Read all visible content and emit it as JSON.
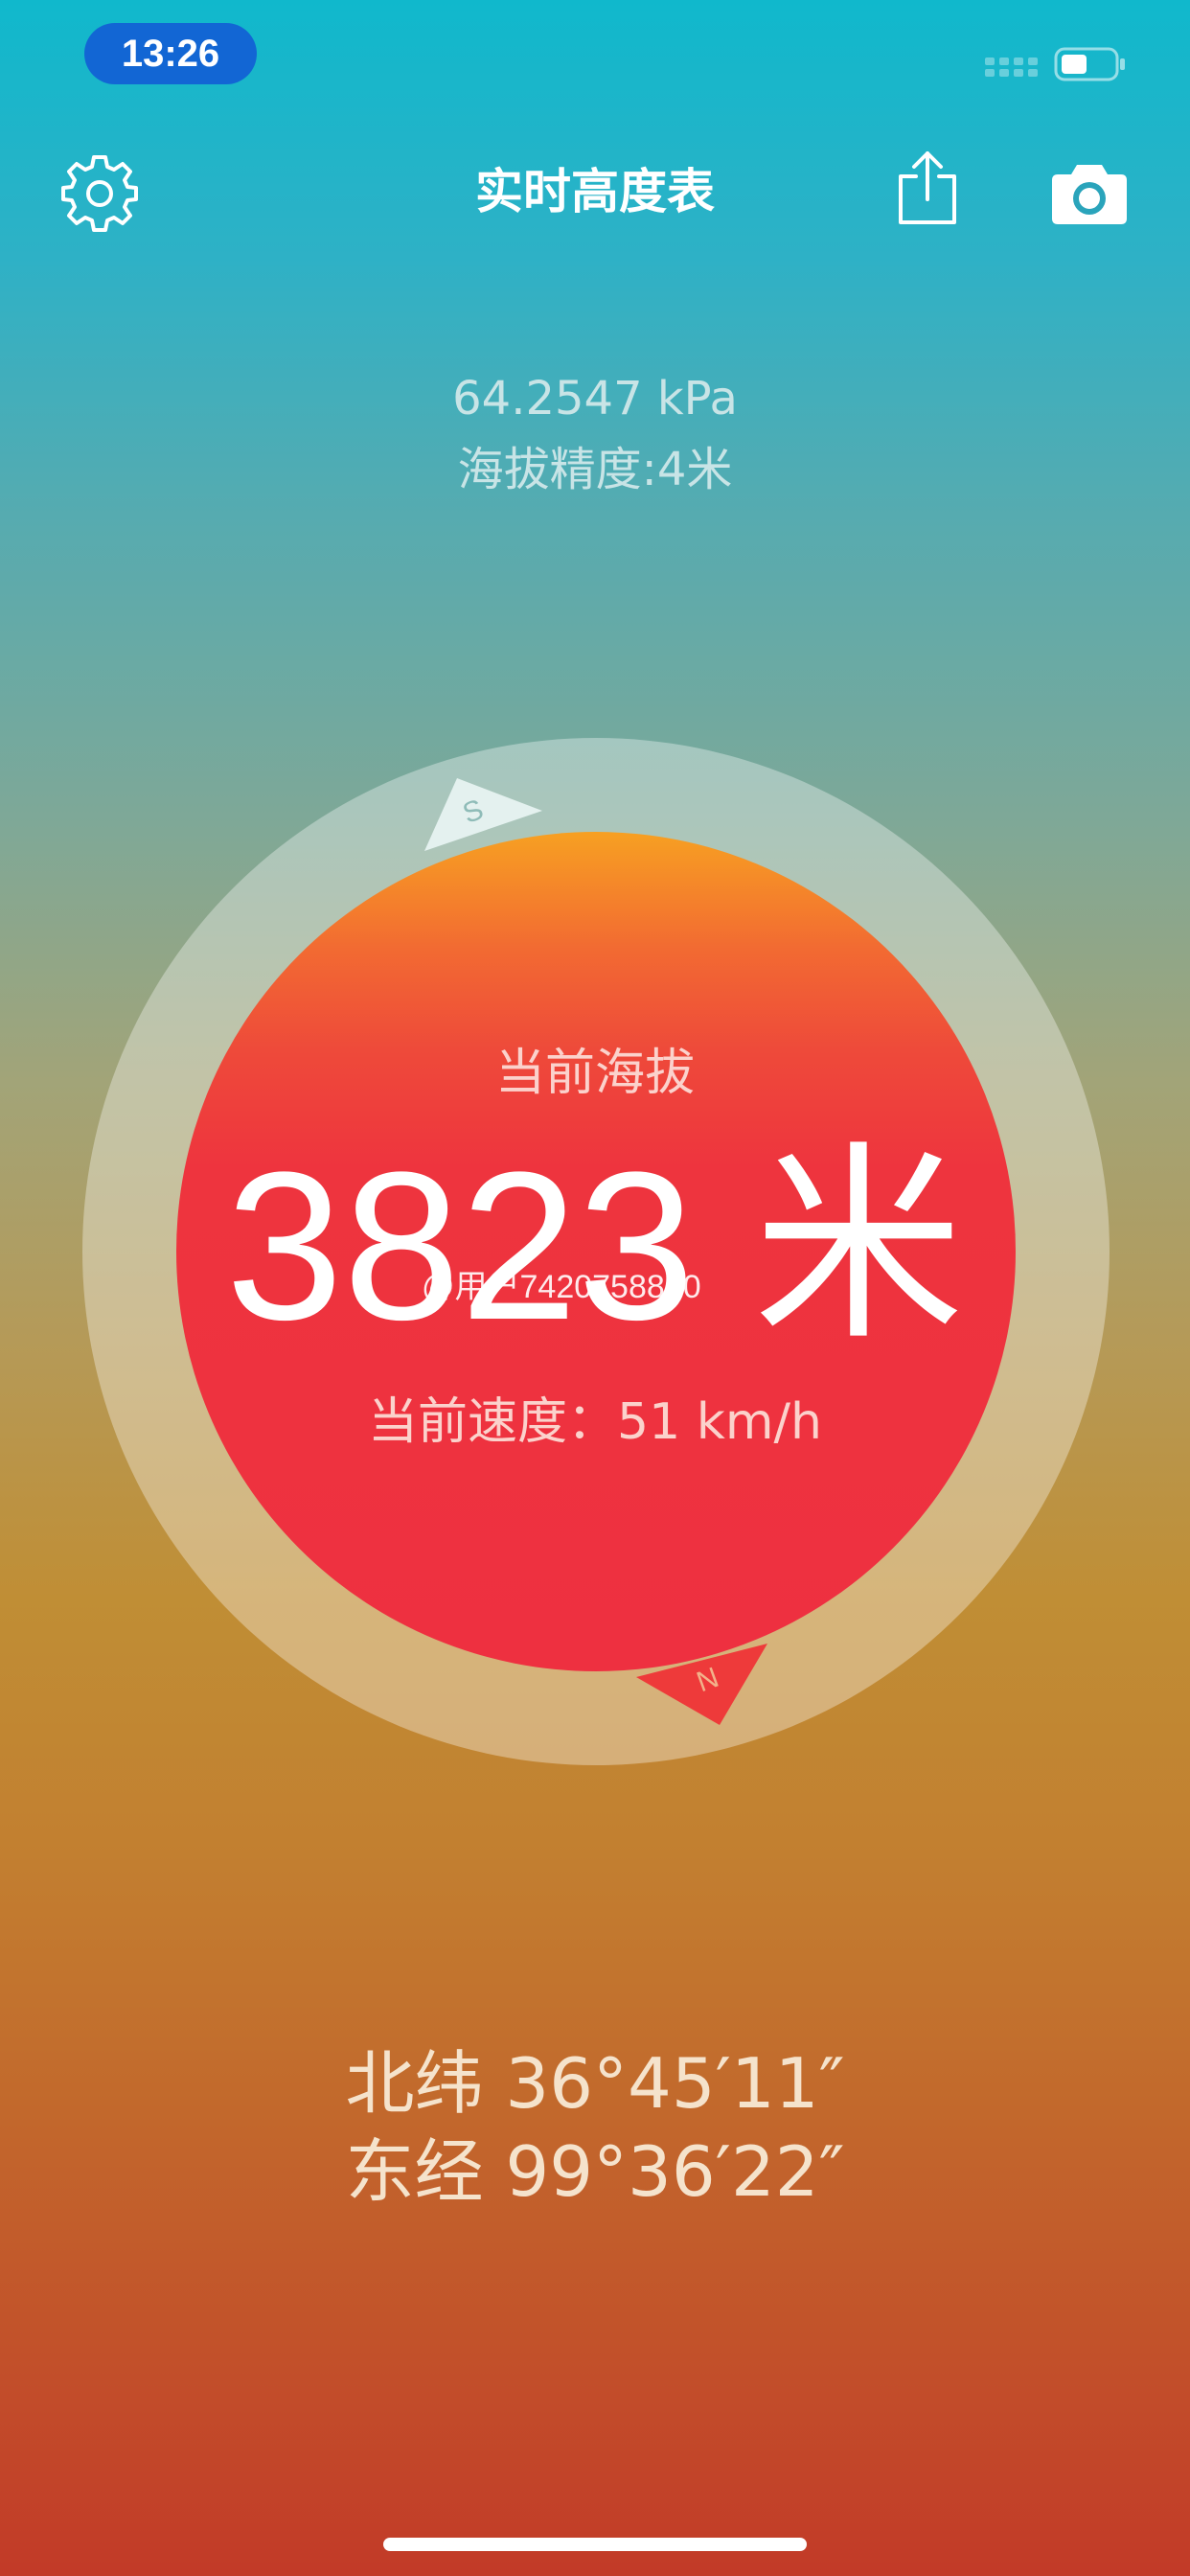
{
  "status_bar": {
    "time": "13:26"
  },
  "nav": {
    "title": "实时高度表",
    "icons": [
      "gear-icon",
      "share-icon",
      "camera-icon"
    ]
  },
  "info": {
    "pressure": "64.2547 kPa",
    "accuracy": "海拔精度:4米"
  },
  "dial": {
    "altitude_label": "当前海拔",
    "altitude_value": "3823 米",
    "speed": "当前速度：51 km/h",
    "compass_south": "S",
    "compass_north": "N",
    "watermark": "@用户7420758820"
  },
  "location": {
    "latitude": "北纬 36°45′11″",
    "longitude": "东经 99°36′22″"
  },
  "colors": {
    "top_background": "#10b8cc",
    "bottom_background": "#c23a28",
    "altitude_circle": "#ee3040",
    "time_pill": "#1266d4"
  }
}
